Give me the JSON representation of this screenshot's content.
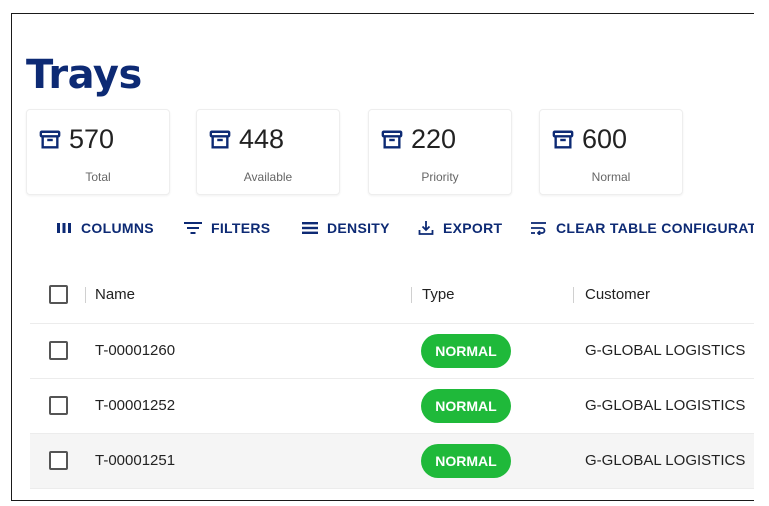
{
  "page": {
    "title": "Trays"
  },
  "stats": [
    {
      "icon": "archive-icon",
      "value": "570",
      "label": "Total"
    },
    {
      "icon": "archive-icon",
      "value": "448",
      "label": "Available"
    },
    {
      "icon": "archive-icon",
      "value": "220",
      "label": "Priority"
    },
    {
      "icon": "archive-icon",
      "value": "600",
      "label": "Normal"
    }
  ],
  "toolbar": {
    "columns": "COLUMNS",
    "filters": "FILTERS",
    "density": "DENSITY",
    "export": "EXPORT",
    "clear": "CLEAR TABLE CONFIGURAT"
  },
  "table": {
    "headers": {
      "name": "Name",
      "type": "Type",
      "customer": "Customer"
    },
    "rows": [
      {
        "name": "T-00001260",
        "type": "NORMAL",
        "customer": "G-GLOBAL LOGISTICS"
      },
      {
        "name": "T-00001252",
        "type": "NORMAL",
        "customer": "G-GLOBAL LOGISTICS"
      },
      {
        "name": "T-00001251",
        "type": "NORMAL",
        "customer": "G-GLOBAL LOGISTICS"
      }
    ]
  },
  "colors": {
    "brand": "#0d2a74",
    "accent": "#1fb93a",
    "row_hover": "#f5f5f5"
  }
}
